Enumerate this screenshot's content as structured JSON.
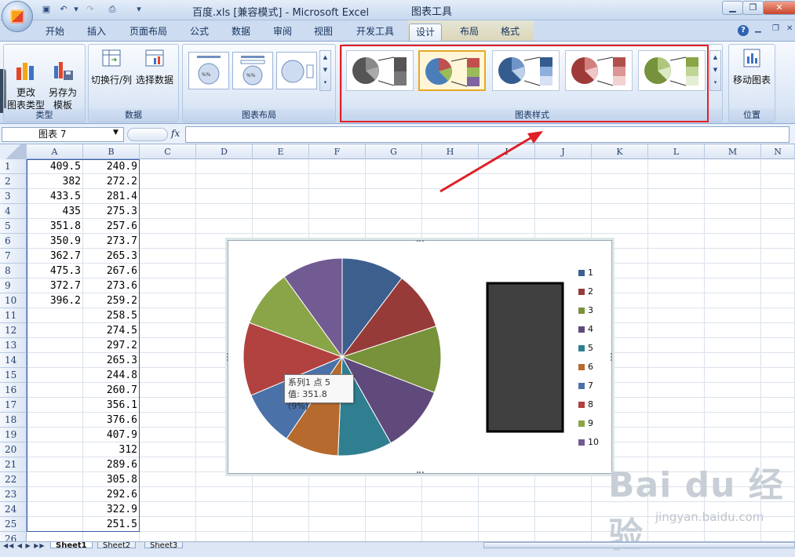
{
  "window": {
    "title": "百度.xls [兼容模式] - Microsoft Excel",
    "context_title": "图表工具",
    "controls": {
      "minimize": "▁",
      "restore": "❐",
      "close": "✕"
    }
  },
  "qat": {
    "save": "▣",
    "undo": "↶",
    "redo": "↷",
    "print": "⎙",
    "more": "▾"
  },
  "tabs": [
    "开始",
    "插入",
    "页面布局",
    "公式",
    "数据",
    "审阅",
    "视图",
    "开发工具",
    "设计",
    "布局",
    "格式"
  ],
  "active_tab": "设计",
  "groups": {
    "type": {
      "label": "类型",
      "btn1": "更改\n图表类型",
      "btn2": "另存为\n模板"
    },
    "data": {
      "label": "数据",
      "btn1": "切换行/列",
      "btn2": "选择数据"
    },
    "layout": {
      "label": "图表布局"
    },
    "styles": {
      "label": "图表样式"
    },
    "location": {
      "label": "位置",
      "btn1": "移动图表"
    }
  },
  "help_icon": "?",
  "formula_bar": {
    "name_box": "图表 7",
    "fx": "fx",
    "content": ""
  },
  "columns": [
    "A",
    "B",
    "C",
    "D",
    "E",
    "F",
    "G",
    "H",
    "I",
    "J",
    "K",
    "L",
    "M",
    "N"
  ],
  "rows": [
    "1",
    "2",
    "3",
    "4",
    "5",
    "6",
    "7",
    "8",
    "9",
    "10",
    "11",
    "12",
    "13",
    "14",
    "15",
    "16",
    "17",
    "18",
    "19",
    "20",
    "21",
    "22",
    "23",
    "24",
    "25",
    "26"
  ],
  "col_a": [
    "409.5",
    "382",
    "433.5",
    "435",
    "351.8",
    "350.9",
    "362.7",
    "475.3",
    "372.7",
    "396.2"
  ],
  "col_b": [
    "240.9",
    "272.2",
    "281.4",
    "275.3",
    "257.6",
    "273.7",
    "265.3",
    "267.6",
    "273.6",
    "259.2",
    "258.5",
    "274.5",
    "297.2",
    "265.3",
    "244.8",
    "260.7",
    "356.1",
    "376.6",
    "407.9",
    "312",
    "289.6",
    "305.8",
    "292.6",
    "322.9",
    "251.5"
  ],
  "chart_data": {
    "type": "pie",
    "categories": [
      "1",
      "2",
      "3",
      "4",
      "5",
      "6",
      "7",
      "8",
      "9",
      "10"
    ],
    "values": [
      409.5,
      382,
      433.5,
      435,
      351.8,
      350.9,
      362.7,
      475.3,
      372.7,
      396.2
    ],
    "colors": [
      "#3d5f8e",
      "#973b38",
      "#78913b",
      "#604a7b",
      "#2f7f91",
      "#b66a2e",
      "#4a72a8",
      "#b1423f",
      "#8aa547",
      "#725a92"
    ],
    "legend_position": "right",
    "tooltip": {
      "line1": "系列1 点 5",
      "line2": "值: 351.8 (9%)"
    }
  },
  "sheets": [
    "Sheet1",
    "Sheet2",
    "Sheet3"
  ],
  "watermark": {
    "logo": "Bai  du 经验",
    "url": "jingyan.baidu.com"
  }
}
